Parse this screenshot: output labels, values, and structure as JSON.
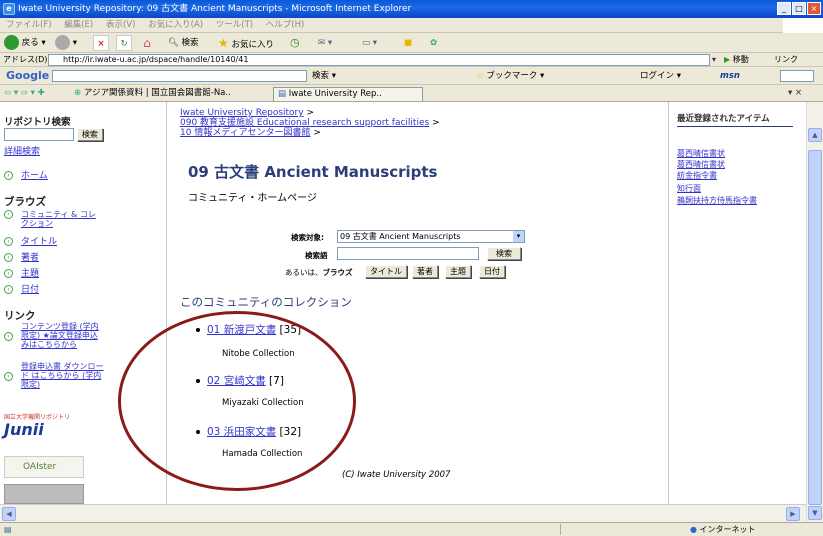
{
  "window": {
    "title": "Iwate University Repository: 09 古文書 Ancient Manuscripts - Microsoft Internet Explorer",
    "minimize": "_",
    "maximize": "□",
    "close": "×"
  },
  "menu": [
    "ファイル(F)",
    "編集(E)",
    "表示(V)",
    "お気に入り(A)",
    "ツール(T)",
    "ヘルプ(H)"
  ],
  "toolbar": {
    "back_label": "戻る",
    "search_label": "検索",
    "favorites_label": "お気に入り"
  },
  "address": {
    "label": "アドレス(D)",
    "url": "http://ir.iwate-u.ac.jp/dspace/handle/10140/41",
    "go_label": "移動",
    "links_label": "リンク"
  },
  "google_bar": {
    "logo": "Google",
    "search_label": "検索",
    "bookmarks_label": "ブックマーク",
    "login_label": "ログイン",
    "msn": "msn"
  },
  "tabs": {
    "fav_link": "アジア関係資料 | 国立国会図書館-Na..",
    "active_tab": "Iwate University Rep.."
  },
  "sidebar": {
    "search_heading": "リポジトリ検索",
    "search_button": "検索",
    "advanced_search": "詳細検索",
    "home": "ホーム",
    "browse_heading": "ブラウズ",
    "browse_items": [
      "コミュニティ & コレクション",
      "タイトル",
      "著者",
      "主題",
      "日付"
    ],
    "links_heading": "リンク",
    "link_items": [
      "コンテンツ登録 (学内限定) ★論文登録申込 みはこちらから",
      "登録申込書 ダウンロード はこちらから (学内限定)"
    ],
    "junii_caption": "国立大学機関リポジトリ",
    "junii_logo": "Junii",
    "oaister_logo": "OAIster"
  },
  "main": {
    "breadcrumbs": [
      "Iwate University Repository",
      "090 教育支援施設 Educational research support facilities",
      "10 情報メディアセンター図書館"
    ],
    "breadcrumb_sep": ">",
    "title": "09 古文書 Ancient Manuscripts",
    "subtitle": "コミュニティ・ホームページ",
    "search_form": {
      "scope_label": "検索対象:",
      "scope_value": "09 古文書 Ancient Manuscripts",
      "query_label": "検索語",
      "search_button": "検索",
      "or_label": "あるいは、",
      "browse_label": "ブラウズ",
      "browse_buttons": [
        "タイトル",
        "著者",
        "主題",
        "日付"
      ]
    },
    "collections_heading": "このコミュニティのコレクション",
    "collections": [
      {
        "name": "01 新渡戸文書",
        "count": "[35]",
        "desc": "Nitobe Collection"
      },
      {
        "name": "02 宮崎文書",
        "count": "[7]",
        "desc": "Miyazaki Collection"
      },
      {
        "name": "03 浜田家文書",
        "count": "[32]",
        "desc": "Hamada Collection"
      }
    ],
    "footer": "(C) Iwate University 2007"
  },
  "recent": {
    "heading": "最近登録されたアイテム",
    "items": [
      "葛西晴信書状",
      "葛西晴信書状",
      "紡金指令書",
      "知行面",
      "鵜飼扶持方侍馬指令書"
    ]
  },
  "status": {
    "zone": "インターネット"
  }
}
